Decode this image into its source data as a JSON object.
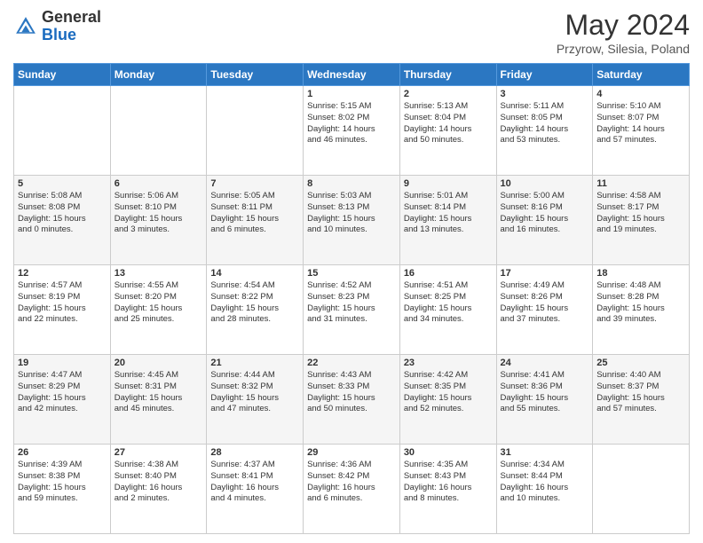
{
  "header": {
    "logo_general": "General",
    "logo_blue": "Blue",
    "month_title": "May 2024",
    "location": "Przyrow, Silesia, Poland"
  },
  "weekdays": [
    "Sunday",
    "Monday",
    "Tuesday",
    "Wednesday",
    "Thursday",
    "Friday",
    "Saturday"
  ],
  "weeks": [
    [
      {
        "day": "",
        "lines": []
      },
      {
        "day": "",
        "lines": []
      },
      {
        "day": "",
        "lines": []
      },
      {
        "day": "1",
        "lines": [
          "Sunrise: 5:15 AM",
          "Sunset: 8:02 PM",
          "Daylight: 14 hours",
          "and 46 minutes."
        ]
      },
      {
        "day": "2",
        "lines": [
          "Sunrise: 5:13 AM",
          "Sunset: 8:04 PM",
          "Daylight: 14 hours",
          "and 50 minutes."
        ]
      },
      {
        "day": "3",
        "lines": [
          "Sunrise: 5:11 AM",
          "Sunset: 8:05 PM",
          "Daylight: 14 hours",
          "and 53 minutes."
        ]
      },
      {
        "day": "4",
        "lines": [
          "Sunrise: 5:10 AM",
          "Sunset: 8:07 PM",
          "Daylight: 14 hours",
          "and 57 minutes."
        ]
      }
    ],
    [
      {
        "day": "5",
        "lines": [
          "Sunrise: 5:08 AM",
          "Sunset: 8:08 PM",
          "Daylight: 15 hours",
          "and 0 minutes."
        ]
      },
      {
        "day": "6",
        "lines": [
          "Sunrise: 5:06 AM",
          "Sunset: 8:10 PM",
          "Daylight: 15 hours",
          "and 3 minutes."
        ]
      },
      {
        "day": "7",
        "lines": [
          "Sunrise: 5:05 AM",
          "Sunset: 8:11 PM",
          "Daylight: 15 hours",
          "and 6 minutes."
        ]
      },
      {
        "day": "8",
        "lines": [
          "Sunrise: 5:03 AM",
          "Sunset: 8:13 PM",
          "Daylight: 15 hours",
          "and 10 minutes."
        ]
      },
      {
        "day": "9",
        "lines": [
          "Sunrise: 5:01 AM",
          "Sunset: 8:14 PM",
          "Daylight: 15 hours",
          "and 13 minutes."
        ]
      },
      {
        "day": "10",
        "lines": [
          "Sunrise: 5:00 AM",
          "Sunset: 8:16 PM",
          "Daylight: 15 hours",
          "and 16 minutes."
        ]
      },
      {
        "day": "11",
        "lines": [
          "Sunrise: 4:58 AM",
          "Sunset: 8:17 PM",
          "Daylight: 15 hours",
          "and 19 minutes."
        ]
      }
    ],
    [
      {
        "day": "12",
        "lines": [
          "Sunrise: 4:57 AM",
          "Sunset: 8:19 PM",
          "Daylight: 15 hours",
          "and 22 minutes."
        ]
      },
      {
        "day": "13",
        "lines": [
          "Sunrise: 4:55 AM",
          "Sunset: 8:20 PM",
          "Daylight: 15 hours",
          "and 25 minutes."
        ]
      },
      {
        "day": "14",
        "lines": [
          "Sunrise: 4:54 AM",
          "Sunset: 8:22 PM",
          "Daylight: 15 hours",
          "and 28 minutes."
        ]
      },
      {
        "day": "15",
        "lines": [
          "Sunrise: 4:52 AM",
          "Sunset: 8:23 PM",
          "Daylight: 15 hours",
          "and 31 minutes."
        ]
      },
      {
        "day": "16",
        "lines": [
          "Sunrise: 4:51 AM",
          "Sunset: 8:25 PM",
          "Daylight: 15 hours",
          "and 34 minutes."
        ]
      },
      {
        "day": "17",
        "lines": [
          "Sunrise: 4:49 AM",
          "Sunset: 8:26 PM",
          "Daylight: 15 hours",
          "and 37 minutes."
        ]
      },
      {
        "day": "18",
        "lines": [
          "Sunrise: 4:48 AM",
          "Sunset: 8:28 PM",
          "Daylight: 15 hours",
          "and 39 minutes."
        ]
      }
    ],
    [
      {
        "day": "19",
        "lines": [
          "Sunrise: 4:47 AM",
          "Sunset: 8:29 PM",
          "Daylight: 15 hours",
          "and 42 minutes."
        ]
      },
      {
        "day": "20",
        "lines": [
          "Sunrise: 4:45 AM",
          "Sunset: 8:31 PM",
          "Daylight: 15 hours",
          "and 45 minutes."
        ]
      },
      {
        "day": "21",
        "lines": [
          "Sunrise: 4:44 AM",
          "Sunset: 8:32 PM",
          "Daylight: 15 hours",
          "and 47 minutes."
        ]
      },
      {
        "day": "22",
        "lines": [
          "Sunrise: 4:43 AM",
          "Sunset: 8:33 PM",
          "Daylight: 15 hours",
          "and 50 minutes."
        ]
      },
      {
        "day": "23",
        "lines": [
          "Sunrise: 4:42 AM",
          "Sunset: 8:35 PM",
          "Daylight: 15 hours",
          "and 52 minutes."
        ]
      },
      {
        "day": "24",
        "lines": [
          "Sunrise: 4:41 AM",
          "Sunset: 8:36 PM",
          "Daylight: 15 hours",
          "and 55 minutes."
        ]
      },
      {
        "day": "25",
        "lines": [
          "Sunrise: 4:40 AM",
          "Sunset: 8:37 PM",
          "Daylight: 15 hours",
          "and 57 minutes."
        ]
      }
    ],
    [
      {
        "day": "26",
        "lines": [
          "Sunrise: 4:39 AM",
          "Sunset: 8:38 PM",
          "Daylight: 15 hours",
          "and 59 minutes."
        ]
      },
      {
        "day": "27",
        "lines": [
          "Sunrise: 4:38 AM",
          "Sunset: 8:40 PM",
          "Daylight: 16 hours",
          "and 2 minutes."
        ]
      },
      {
        "day": "28",
        "lines": [
          "Sunrise: 4:37 AM",
          "Sunset: 8:41 PM",
          "Daylight: 16 hours",
          "and 4 minutes."
        ]
      },
      {
        "day": "29",
        "lines": [
          "Sunrise: 4:36 AM",
          "Sunset: 8:42 PM",
          "Daylight: 16 hours",
          "and 6 minutes."
        ]
      },
      {
        "day": "30",
        "lines": [
          "Sunrise: 4:35 AM",
          "Sunset: 8:43 PM",
          "Daylight: 16 hours",
          "and 8 minutes."
        ]
      },
      {
        "day": "31",
        "lines": [
          "Sunrise: 4:34 AM",
          "Sunset: 8:44 PM",
          "Daylight: 16 hours",
          "and 10 minutes."
        ]
      },
      {
        "day": "",
        "lines": []
      }
    ]
  ]
}
